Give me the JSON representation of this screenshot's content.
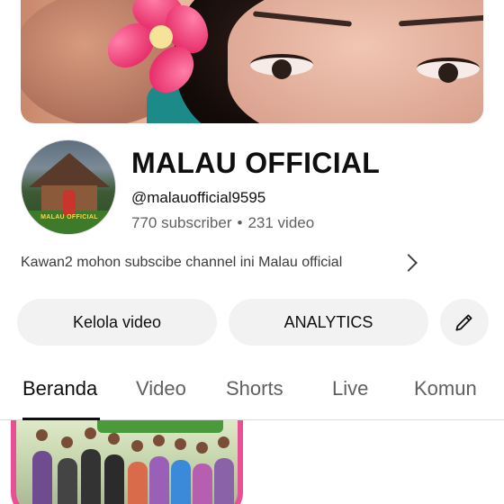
{
  "channel": {
    "name": "MALAU OFFICIAL",
    "handle": "@malauofficial9595",
    "subscribers": "770 subscriber",
    "separator": "•",
    "videos": "231 video",
    "description": "Kawan2 mohon subscibe channel ini Malau official",
    "avatar_caption": "MALAU OFFICIAL"
  },
  "actions": {
    "manage_videos": "Kelola video",
    "analytics": "ANALYTICS",
    "edit_icon": "pencil-icon"
  },
  "tabs": [
    {
      "label": "Beranda",
      "active": true
    },
    {
      "label": "Video",
      "active": false
    },
    {
      "label": "Shorts",
      "active": false
    },
    {
      "label": "Live",
      "active": false
    },
    {
      "label": "Komun",
      "active": false
    }
  ],
  "colors": {
    "accent_pink": "#e94f95",
    "button_bg": "#f2f2f2",
    "muted_text": "#606060"
  }
}
